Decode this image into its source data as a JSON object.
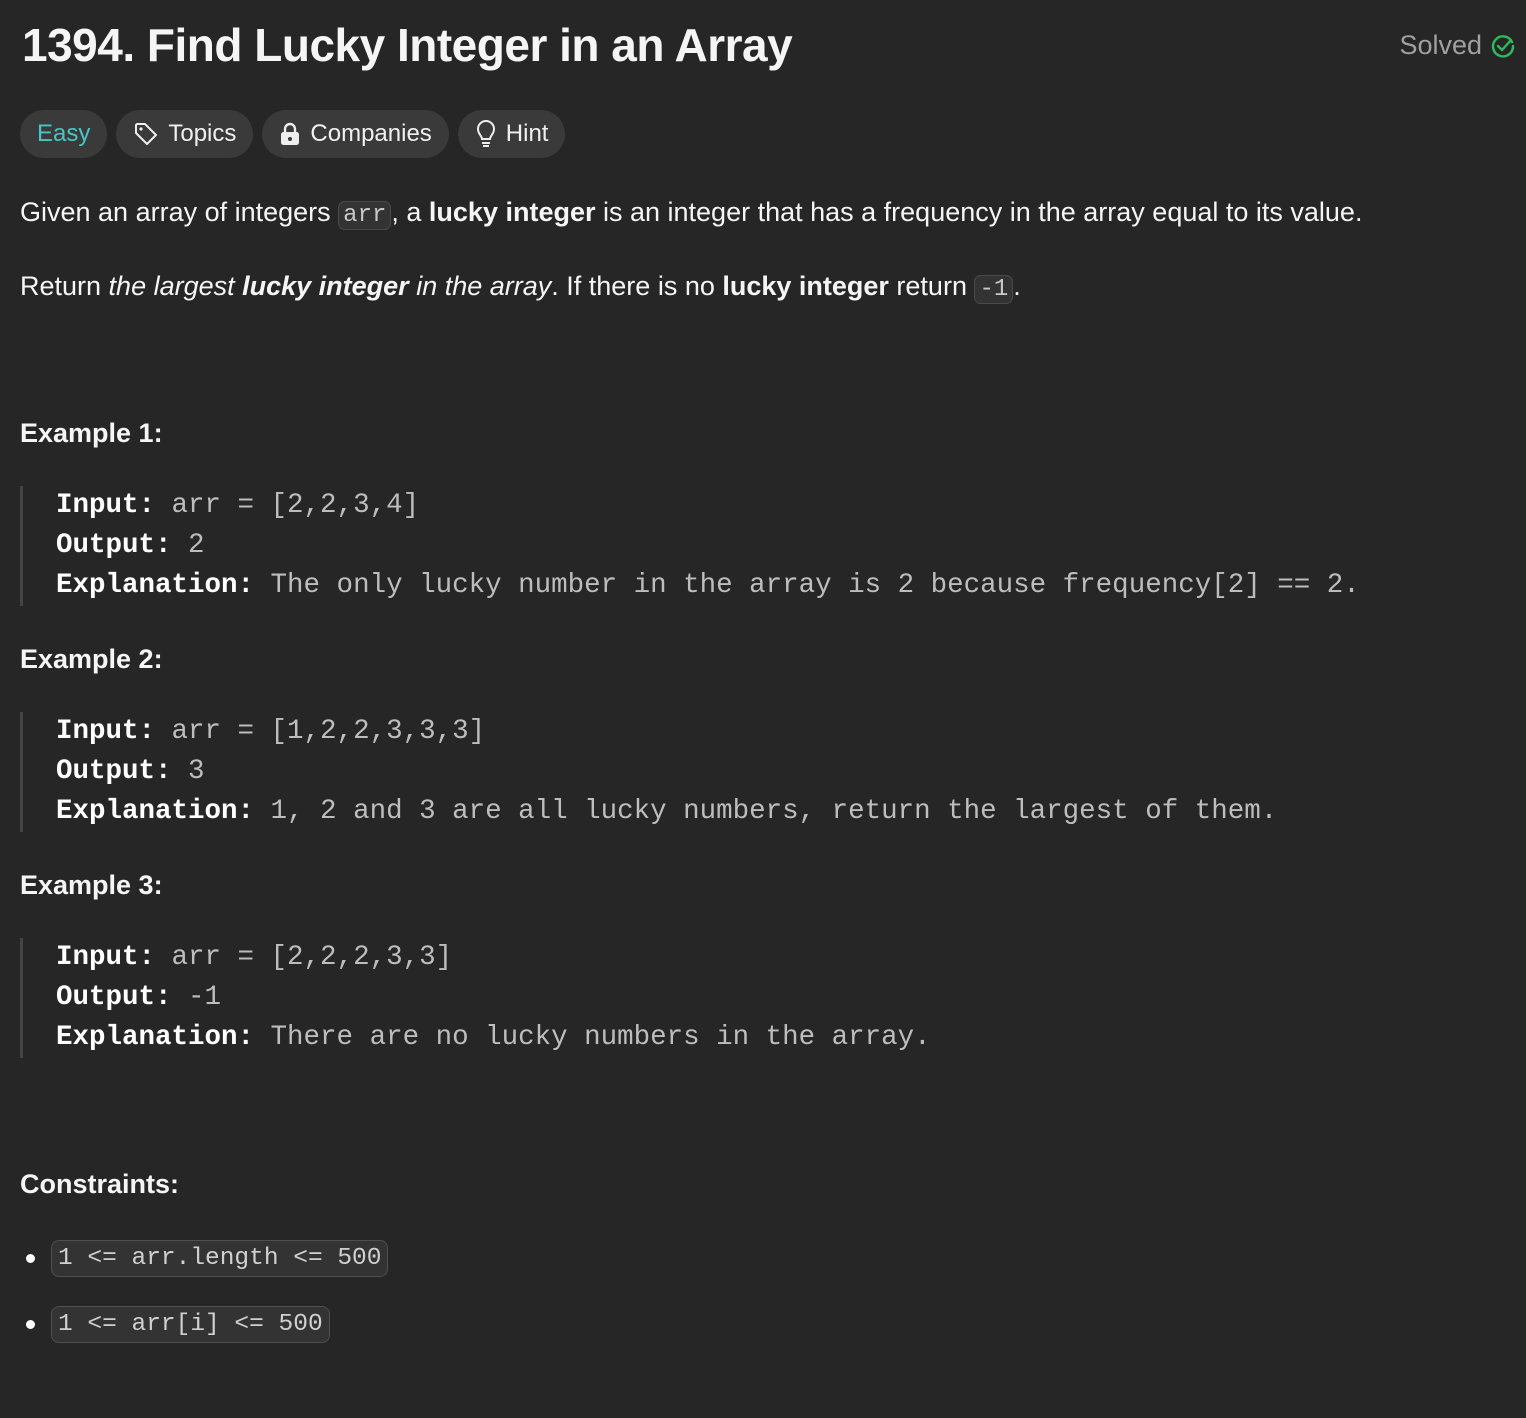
{
  "title": "1394. Find Lucky Integer in an Array",
  "status": {
    "label": "Solved",
    "color": "#2cbb5d"
  },
  "tags": {
    "difficulty": "Easy",
    "topics": "Topics",
    "companies": "Companies",
    "hint": "Hint"
  },
  "description": {
    "p1": {
      "a": "Given an array of integers ",
      "code": "arr",
      "b": ", a ",
      "bold": "lucky integer",
      "c": " is an integer that has a frequency in the array equal to its value."
    },
    "p2": {
      "a": "Return ",
      "i1": "the largest ",
      "bi": "lucky integer",
      "i2": " in the array",
      "b": ". If there is no ",
      "bold": "lucky integer",
      "c": " return ",
      "code": "-1",
      "d": "."
    }
  },
  "examples": [
    {
      "heading": "Example 1:",
      "input_label": "Input:",
      "input": " arr = [2,2,3,4]",
      "output_label": "Output:",
      "output": " 2",
      "explanation_label": "Explanation:",
      "explanation": " The only lucky number in the array is 2 because frequency[2] == 2."
    },
    {
      "heading": "Example 2:",
      "input_label": "Input:",
      "input": " arr = [1,2,2,3,3,3]",
      "output_label": "Output:",
      "output": " 3",
      "explanation_label": "Explanation:",
      "explanation": " 1, 2 and 3 are all lucky numbers, return the largest of them."
    },
    {
      "heading": "Example 3:",
      "input_label": "Input:",
      "input": " arr = [2,2,2,3,3]",
      "output_label": "Output:",
      "output": " -1",
      "explanation_label": "Explanation:",
      "explanation": " There are no lucky numbers in the array."
    }
  ],
  "constraints": {
    "heading": "Constraints:",
    "items": [
      "1 <= arr.length <= 500",
      "1 <= arr[i] <= 500"
    ]
  }
}
